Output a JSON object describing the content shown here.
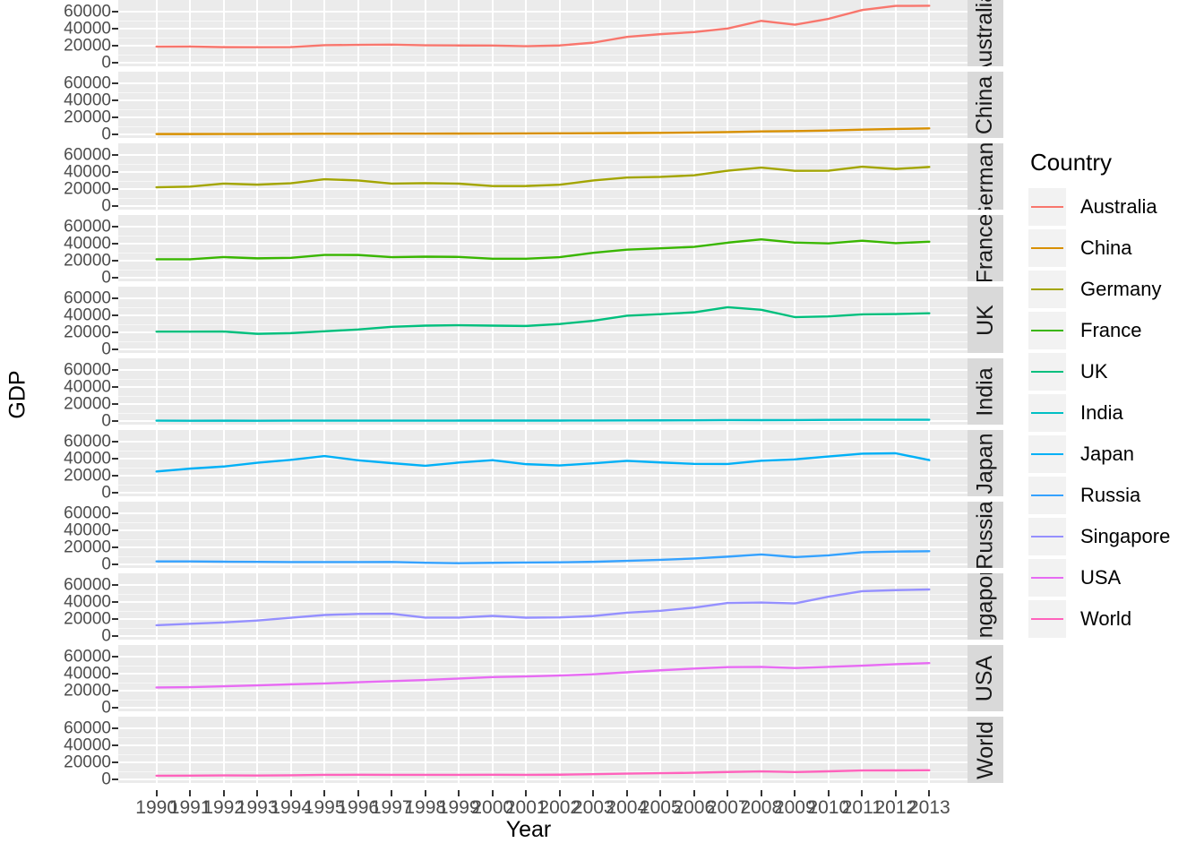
{
  "chart_data": {
    "type": "line",
    "title": "",
    "xlabel": "Year",
    "ylabel": "GDP",
    "legend_title": "Country",
    "legend_position": "right",
    "grid": true,
    "facet": "Country (rows, strip on right)",
    "x": [
      1990,
      1991,
      1992,
      1993,
      1994,
      1995,
      1996,
      1997,
      1998,
      1999,
      2000,
      2001,
      2002,
      2003,
      2004,
      2005,
      2006,
      2007,
      2008,
      2009,
      2010,
      2011,
      2012,
      2013
    ],
    "xlim": [
      1990,
      2013
    ],
    "ylim": [
      0,
      70000
    ],
    "y_ticks": [
      0,
      20000,
      40000,
      60000
    ],
    "x_tick_labels": [
      "1990",
      "1991",
      "1992",
      "1993",
      "1994",
      "1995",
      "1996",
      "1997",
      "1998",
      "1999",
      "2000",
      "2001",
      "2002",
      "2003",
      "2004",
      "2005",
      "2006",
      "2007",
      "2008",
      "2009",
      "2010",
      "2011",
      "2012",
      "2013"
    ],
    "series": [
      {
        "name": "Australia",
        "facet_label": "Australia",
        "color": "#f8766d",
        "values": [
          19000,
          19100,
          18400,
          18300,
          18500,
          20700,
          21100,
          21400,
          20600,
          20400,
          20300,
          19500,
          20400,
          23700,
          30600,
          33800,
          36300,
          40500,
          49600,
          45000,
          52000,
          62400,
          67300,
          67500
        ]
      },
      {
        "name": "China",
        "facet_label": "China",
        "color": "#d89000",
        "values": [
          316,
          333,
          366,
          377,
          473,
          604,
          703,
          774,
          821,
          865,
          959,
          1053,
          1148,
          1288,
          1508,
          1753,
          2099,
          2694,
          3468,
          3832,
          4560,
          5618,
          6337,
          7078
        ]
      },
      {
        "name": "Germany",
        "facet_label": "Germany",
        "color": "#a3a500",
        "values": [
          22200,
          23000,
          26600,
          25300,
          27000,
          31700,
          30300,
          26600,
          27100,
          26500,
          23600,
          23700,
          25200,
          30300,
          33700,
          34500,
          36400,
          41800,
          45600,
          41700,
          41800,
          46600,
          43900,
          46300
        ]
      },
      {
        "name": "France",
        "facet_label": "France",
        "color": "#39b600",
        "values": [
          21800,
          21800,
          24400,
          22900,
          23500,
          27000,
          26900,
          24300,
          24900,
          24600,
          22400,
          22400,
          24300,
          29500,
          33200,
          34800,
          36500,
          41500,
          45400,
          41600,
          40600,
          43800,
          40900,
          42600
        ]
      },
      {
        "name": "UK",
        "facet_label": "UK",
        "color": "#00bf7d",
        "values": [
          21000,
          21000,
          21100,
          18400,
          19200,
          21400,
          23500,
          26700,
          28100,
          28600,
          28100,
          27700,
          30000,
          33900,
          39900,
          41700,
          43900,
          50000,
          46900,
          38200,
          39100,
          41400,
          41800,
          42800
        ]
      },
      {
        "name": "India",
        "facet_label": "India",
        "color": "#00bfc4",
        "values": [
          368,
          303,
          318,
          302,
          345,
          375,
          399,
          415,
          413,
          442,
          443,
          449,
          468,
          544,
          632,
          715,
          806,
          1018,
          991,
          1090,
          1345,
          1461,
          1430,
          1452
        ]
      },
      {
        "name": "Japan",
        "facet_label": "Japan",
        "color": "#00b0f6",
        "values": [
          25100,
          28500,
          31000,
          35500,
          38900,
          43400,
          38400,
          35000,
          31900,
          35700,
          38500,
          33800,
          32300,
          34800,
          37700,
          35800,
          34100,
          34000,
          37900,
          39500,
          42900,
          46200,
          46700,
          38600
        ]
      },
      {
        "name": "Russia",
        "facet_label": "Russia",
        "color": "#35a2ff",
        "values": [
          3485,
          3490,
          3100,
          2930,
          2670,
          2670,
          2640,
          2740,
          1835,
          1330,
          1775,
          2100,
          2375,
          2975,
          4100,
          5320,
          6920,
          9100,
          11700,
          8560,
          10670,
          14350,
          15150,
          15550
        ]
      },
      {
        "name": "Singapore",
        "facet_label": "Singapore",
        "color": "#9590ff",
        "values": [
          12760,
          14500,
          16100,
          18300,
          21600,
          24900,
          26200,
          26400,
          21800,
          21800,
          23850,
          21700,
          22000,
          23700,
          27600,
          29900,
          33600,
          39200,
          39700,
          38600,
          46600,
          53100,
          54400,
          55200
        ]
      },
      {
        "name": "USA",
        "facet_label": "USA",
        "color": "#e76bf3",
        "values": [
          23900,
          24300,
          25400,
          26400,
          27700,
          28700,
          30100,
          31500,
          32800,
          34500,
          36300,
          37100,
          38100,
          39600,
          41900,
          44300,
          46400,
          48100,
          48400,
          47000,
          48400,
          49800,
          51500,
          52900
        ]
      },
      {
        "name": "World",
        "facet_label": "World",
        "color": "#ff62bc",
        "values": [
          4290,
          4400,
          4650,
          4550,
          4790,
          5300,
          5400,
          5350,
          5260,
          5330,
          5450,
          5330,
          5520,
          6080,
          6750,
          7260,
          7800,
          8700,
          9440,
          8630,
          9500,
          10500,
          10560,
          10750
        ]
      }
    ]
  },
  "axes": {
    "y_title": "GDP",
    "x_title": "Year",
    "y_tick_labels": [
      "60000",
      "40000",
      "20000",
      "0"
    ]
  },
  "legend": {
    "title": "Country",
    "items": [
      {
        "label": "Australia",
        "color": "#f8766d"
      },
      {
        "label": "China",
        "color": "#d89000"
      },
      {
        "label": "Germany",
        "color": "#a3a500"
      },
      {
        "label": "France",
        "color": "#39b600"
      },
      {
        "label": "UK",
        "color": "#00bf7d"
      },
      {
        "label": "India",
        "color": "#00bfc4"
      },
      {
        "label": "Japan",
        "color": "#00b0f6"
      },
      {
        "label": "Russia",
        "color": "#35a2ff"
      },
      {
        "label": "Singapore",
        "color": "#9590ff"
      },
      {
        "label": "USA",
        "color": "#e76bf3"
      },
      {
        "label": "World",
        "color": "#ff62bc"
      }
    ]
  },
  "facet_strips": [
    "Australia",
    "China",
    "Germany",
    "France",
    "UK",
    "India",
    "Japan",
    "Russia",
    "Singapore",
    "USA",
    "World"
  ]
}
